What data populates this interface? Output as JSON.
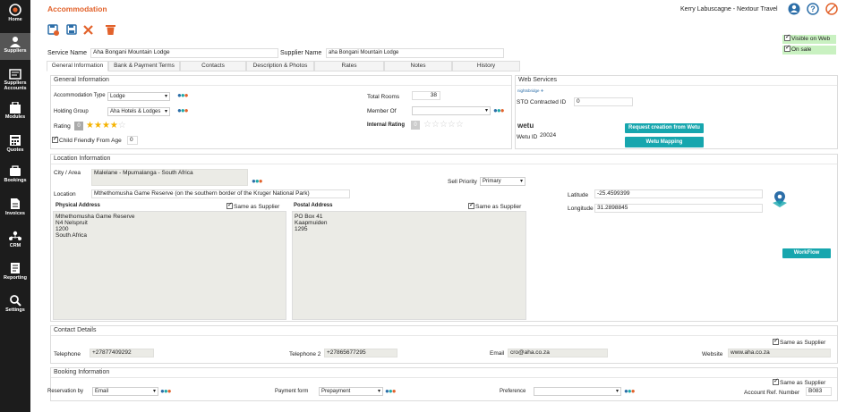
{
  "sidebar": {
    "items": [
      {
        "label": "Home",
        "icon": "home-icon"
      },
      {
        "label": "Suppliers",
        "icon": "suppliers-icon",
        "active": true
      },
      {
        "label": "Suppliers Accounts",
        "icon": "suppliers-accounts-icon"
      },
      {
        "label": "Modules",
        "icon": "modules-icon"
      },
      {
        "label": "Quotes",
        "icon": "quotes-icon"
      },
      {
        "label": "Bookings",
        "icon": "bookings-icon"
      },
      {
        "label": "Invoices",
        "icon": "invoices-icon"
      },
      {
        "label": "CRM",
        "icon": "crm-icon"
      },
      {
        "label": "Reporting",
        "icon": "reporting-icon"
      },
      {
        "label": "Settings",
        "icon": "settings-icon"
      }
    ]
  },
  "header": {
    "title": "Accommodation",
    "user": "Kerry Labuscagne - Nextour Travel",
    "accent": "#e2622b",
    "teal": "#17a6ae"
  },
  "toolbar": {
    "save_icon": "save-check-icon",
    "save2_icon": "save-icon",
    "close_icon": "close-icon",
    "delete_icon": "delete-icon"
  },
  "flags": {
    "visible_on_web": "Visible on Web",
    "on_sale": "On sale"
  },
  "service": {
    "service_label": "Service Name",
    "service_value": "Aha Bongani Mountain Lodge",
    "supplier_label": "Supplier Name",
    "supplier_value": "aha Bongani Mountain Lodge"
  },
  "tabs": [
    "General Information",
    "Bank & Payment Terms",
    "Contacts",
    "Description & Photos",
    "Rates",
    "Notes",
    "History"
  ],
  "general": {
    "heading": "General Information",
    "acc_type_label": "Accommodation Type",
    "acc_type_value": "Lodge",
    "holding_group_label": "Holding Group",
    "holding_group_value": "Aha Hotels & Lodges",
    "rating_label": "Rating",
    "rating_badge": "0",
    "rating_stars": 4,
    "child_label": "Child Friendly From Age",
    "child_value": "0",
    "total_rooms_label": "Total Rooms",
    "total_rooms_value": "38",
    "member_of_label": "Member Of",
    "member_of_value": "",
    "internal_rating_label": "Internal Rating",
    "internal_rating_badge": "0",
    "internal_rating_stars": 0
  },
  "web": {
    "heading": "Web Services",
    "nightsbridge": "nightsbridge",
    "sto_label": "STO Contracted ID",
    "sto_value": "0",
    "wetu_logo": "wetu",
    "wetu_id_label": "Wetu ID",
    "wetu_id_value": "20024",
    "request_btn": "Request creation from Wetu",
    "mapping_btn": "Wetu Mapping"
  },
  "location": {
    "heading": "Location Information",
    "city_label": "City / Area",
    "city_value": "Malelane - Mpumalanga - South Africa",
    "sell_priority_label": "Sell Priority",
    "sell_priority_value": "Primary",
    "location_label": "Location",
    "location_value": "Mthethomusha Game Reserve (on the southern border of the Kruger National Park)",
    "same_as_supplier": "Same as Supplier",
    "physical_label": "Physical Address",
    "physical_value": "Mthethomusha Game Reserve\nN4 Nelspruit\n1200\nSouth Africa",
    "postal_label": "Postal Address",
    "postal_value": "PO Box 41\nKaapmuiden\n1295",
    "latitude_label": "Latitude",
    "latitude_value": "-25.4599399",
    "longitude_label": "Longitude",
    "longitude_value": "31.2898845",
    "workflow_btn": "WorkFlow"
  },
  "contact": {
    "heading": "Contact Details",
    "same_as_supplier": "Same as Supplier",
    "telephone_label": "Telephone",
    "telephone_value": "+27877409292",
    "telephone2_label": "Telephone 2",
    "telephone2_value": "+27865677295",
    "email_label": "Email",
    "email_value": "cro@aha.co.za",
    "website_label": "Website",
    "website_value": "www.aha.co.za"
  },
  "booking": {
    "heading": "Booking Information",
    "same_as_supplier": "Same as Supplier",
    "reservation_label": "Reservation by",
    "reservation_value": "Email",
    "payment_label": "Payment form",
    "payment_value": "Prepayment",
    "preference_label": "Preference",
    "preference_value": "",
    "account_ref_label": "Account Ref. Number",
    "account_ref_value": "B083"
  }
}
